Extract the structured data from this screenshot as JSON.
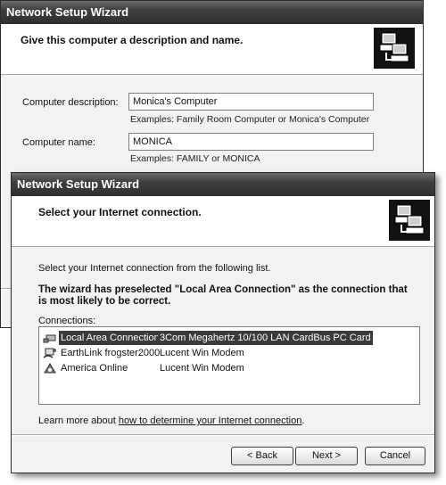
{
  "back_window": {
    "title": "Network Setup Wizard",
    "header_title": "Give this computer a description and name.",
    "description": {
      "label": "Computer description:",
      "value": "Monica's Computer",
      "example": "Examples: Family Room Computer or Monica's Computer"
    },
    "name": {
      "label": "Computer name:",
      "value": "MONICA",
      "example": "Examples: FAMILY or MONICA"
    }
  },
  "front_window": {
    "title": "Network Setup Wizard",
    "header_title": "Select your Internet connection.",
    "instruction": "Select your Internet connection from the following list.",
    "preselect_notice": "The wizard has preselected \"Local Area Connection\" as the connection that is most likely to be correct.",
    "connections_label": "Connections:",
    "connections": [
      {
        "name": "Local Area Connection",
        "device": "3Com Megahertz 10/100 LAN CardBus PC Card",
        "icon": "lan-icon",
        "selected": true
      },
      {
        "name": "EarthLink frogster2000",
        "device": "Lucent Win Modem",
        "icon": "dialup-icon",
        "selected": false
      },
      {
        "name": "America Online",
        "device": "Lucent Win Modem",
        "icon": "aol-icon",
        "selected": false
      }
    ],
    "learn_more_prefix": "Learn more about ",
    "learn_more_link": "how to determine your Internet connection",
    "learn_more_suffix": ".",
    "buttons": {
      "back": "< Back",
      "next": "Next >",
      "cancel": "Cancel"
    }
  }
}
